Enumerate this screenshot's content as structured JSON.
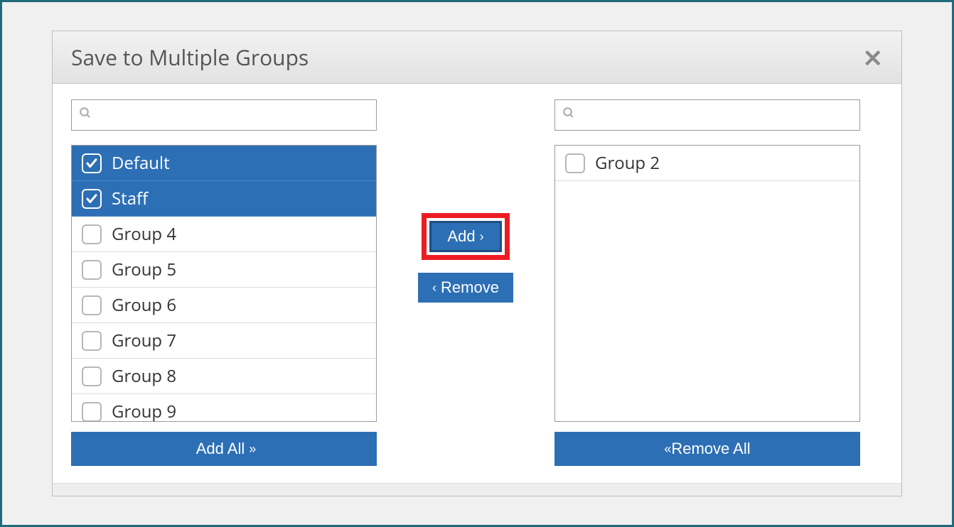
{
  "dialog": {
    "title": "Save to Multiple Groups",
    "close_label": "Close"
  },
  "left": {
    "search_placeholder": "",
    "items": [
      {
        "label": "Default",
        "selected": true
      },
      {
        "label": "Staff",
        "selected": true
      },
      {
        "label": "Group 4",
        "selected": false
      },
      {
        "label": "Group 5",
        "selected": false
      },
      {
        "label": "Group 6",
        "selected": false
      },
      {
        "label": "Group 7",
        "selected": false
      },
      {
        "label": "Group 8",
        "selected": false
      },
      {
        "label": "Group 9",
        "selected": false
      }
    ],
    "add_all_label": "Add All"
  },
  "right": {
    "search_placeholder": "",
    "items": [
      {
        "label": "Group 2",
        "selected": false
      }
    ],
    "remove_all_label": "Remove All"
  },
  "middle": {
    "add_label": "Add",
    "remove_label": "Remove"
  },
  "colors": {
    "primary": "#2d6fb5",
    "highlight": "#ed1c24",
    "frame": "#1f6a7a"
  }
}
